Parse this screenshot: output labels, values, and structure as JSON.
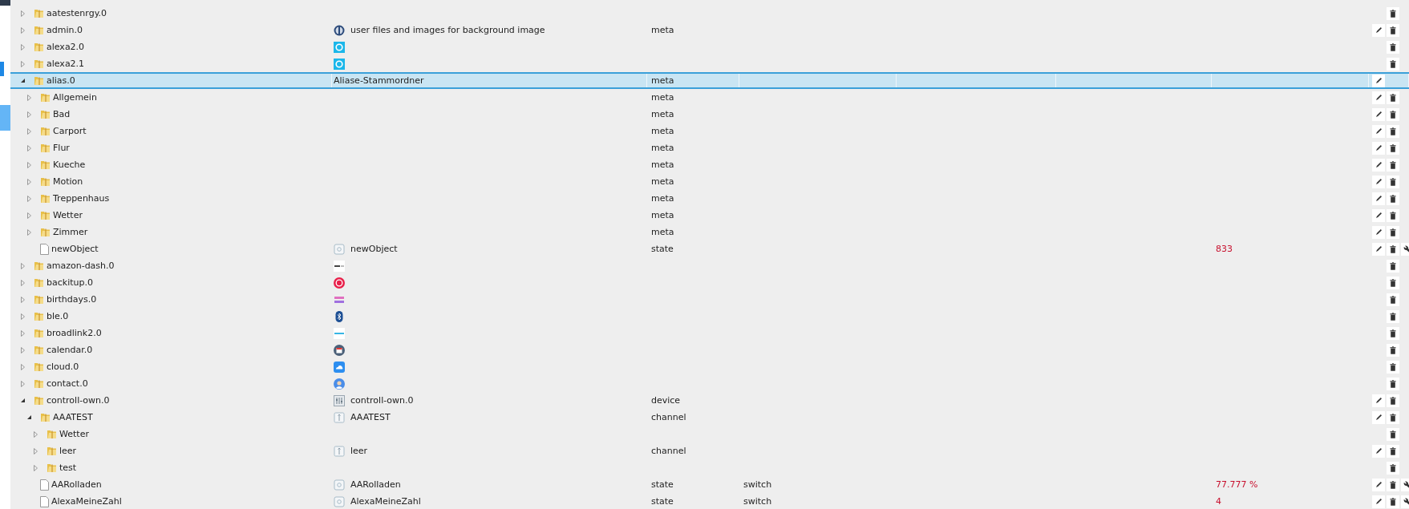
{
  "tree": {
    "rows": [
      {
        "name": "aatestenrgy.0",
        "kind": "folder",
        "expanded": false,
        "selected": false,
        "delete": true,
        "edit": false,
        "custom": false
      },
      {
        "name": "admin.0",
        "kind": "folder",
        "expanded": false,
        "selected": false,
        "label": "user files and images for background image",
        "type": "meta",
        "delete": true,
        "edit": true,
        "custom": false
      },
      {
        "name": "alexa2.0",
        "kind": "folder",
        "expanded": false,
        "selected": false,
        "delete": true,
        "edit": false,
        "custom": false
      },
      {
        "name": "alexa2.1",
        "kind": "folder",
        "expanded": false,
        "selected": false,
        "delete": true,
        "edit": false,
        "custom": false
      },
      {
        "name": "alias.0",
        "kind": "folder",
        "expanded": true,
        "selected": true,
        "label": "Aliase-Stammordner",
        "type": "meta",
        "delete": false,
        "edit": true,
        "custom": false,
        "children": [
          {
            "name": "Allgemein",
            "kind": "folder",
            "expanded": false,
            "selected": false,
            "type": "meta",
            "delete": true,
            "edit": true,
            "custom": false
          },
          {
            "name": "Bad",
            "kind": "folder",
            "expanded": false,
            "selected": false,
            "type": "meta",
            "delete": true,
            "edit": true,
            "custom": false
          },
          {
            "name": "Carport",
            "kind": "folder",
            "expanded": false,
            "selected": false,
            "type": "meta",
            "delete": true,
            "edit": true,
            "custom": false
          },
          {
            "name": "Flur",
            "kind": "folder",
            "expanded": false,
            "selected": false,
            "type": "meta",
            "delete": true,
            "edit": true,
            "custom": false
          },
          {
            "name": "Kueche",
            "kind": "folder",
            "expanded": false,
            "selected": false,
            "type": "meta",
            "delete": true,
            "edit": true,
            "custom": false
          },
          {
            "name": "Motion",
            "kind": "folder",
            "expanded": false,
            "selected": false,
            "type": "meta",
            "delete": true,
            "edit": true,
            "custom": false
          },
          {
            "name": "Treppenhaus",
            "kind": "folder",
            "expanded": false,
            "selected": false,
            "type": "meta",
            "delete": true,
            "edit": true,
            "custom": false
          },
          {
            "name": "Wetter",
            "kind": "folder",
            "expanded": false,
            "selected": false,
            "type": "meta",
            "delete": true,
            "edit": true,
            "custom": false
          },
          {
            "name": "Zimmer",
            "kind": "folder",
            "expanded": false,
            "selected": false,
            "type": "meta",
            "delete": true,
            "edit": true,
            "custom": false
          },
          {
            "name": "newObject",
            "kind": "file",
            "selected": false,
            "label": "newObject",
            "type": "state",
            "value": "833",
            "delete": true,
            "edit": true,
            "custom": true
          }
        ]
      },
      {
        "name": "amazon-dash.0",
        "kind": "folder",
        "expanded": false,
        "selected": false,
        "delete": true,
        "edit": false,
        "custom": false
      },
      {
        "name": "backitup.0",
        "kind": "folder",
        "expanded": false,
        "selected": false,
        "delete": true,
        "edit": false,
        "custom": false
      },
      {
        "name": "birthdays.0",
        "kind": "folder",
        "expanded": false,
        "selected": false,
        "delete": true,
        "edit": false,
        "custom": false
      },
      {
        "name": "ble.0",
        "kind": "folder",
        "expanded": false,
        "selected": false,
        "delete": true,
        "edit": false,
        "custom": false
      },
      {
        "name": "broadlink2.0",
        "kind": "folder",
        "expanded": false,
        "selected": false,
        "delete": true,
        "edit": false,
        "custom": false
      },
      {
        "name": "calendar.0",
        "kind": "folder",
        "expanded": false,
        "selected": false,
        "delete": true,
        "edit": false,
        "custom": false
      },
      {
        "name": "cloud.0",
        "kind": "folder",
        "expanded": false,
        "selected": false,
        "delete": true,
        "edit": false,
        "custom": false
      },
      {
        "name": "contact.0",
        "kind": "folder",
        "expanded": false,
        "selected": false,
        "delete": true,
        "edit": false,
        "custom": false
      },
      {
        "name": "controll-own.0",
        "kind": "folder",
        "expanded": true,
        "selected": false,
        "label": "controll-own.0",
        "type": "device",
        "delete": true,
        "edit": true,
        "custom": false,
        "children": [
          {
            "name": "AAATEST",
            "kind": "folder",
            "expanded": true,
            "selected": false,
            "label": "AAATEST",
            "type": "channel",
            "delete": true,
            "edit": true,
            "custom": false,
            "children": [
              {
                "name": "Wetter",
                "kind": "folder",
                "expanded": false,
                "selected": false,
                "delete": true,
                "edit": false,
                "custom": false
              },
              {
                "name": "leer",
                "kind": "folder",
                "expanded": false,
                "selected": false,
                "label": "leer",
                "type": "channel",
                "delete": true,
                "edit": true,
                "custom": false
              },
              {
                "name": "test",
                "kind": "folder",
                "expanded": false,
                "selected": false,
                "delete": true,
                "edit": false,
                "custom": false
              }
            ]
          },
          {
            "name": "AARolladen",
            "kind": "file",
            "selected": false,
            "label": "AARolladen",
            "type": "state",
            "role": "switch",
            "value": "77.777 %",
            "delete": true,
            "edit": true,
            "custom": true
          },
          {
            "name": "AlexaMeineZahl",
            "kind": "file",
            "selected": false,
            "label": "AlexaMeineZahl",
            "type": "state",
            "role": "switch",
            "value": "4",
            "delete": true,
            "edit": true,
            "custom": true
          }
        ]
      }
    ]
  }
}
